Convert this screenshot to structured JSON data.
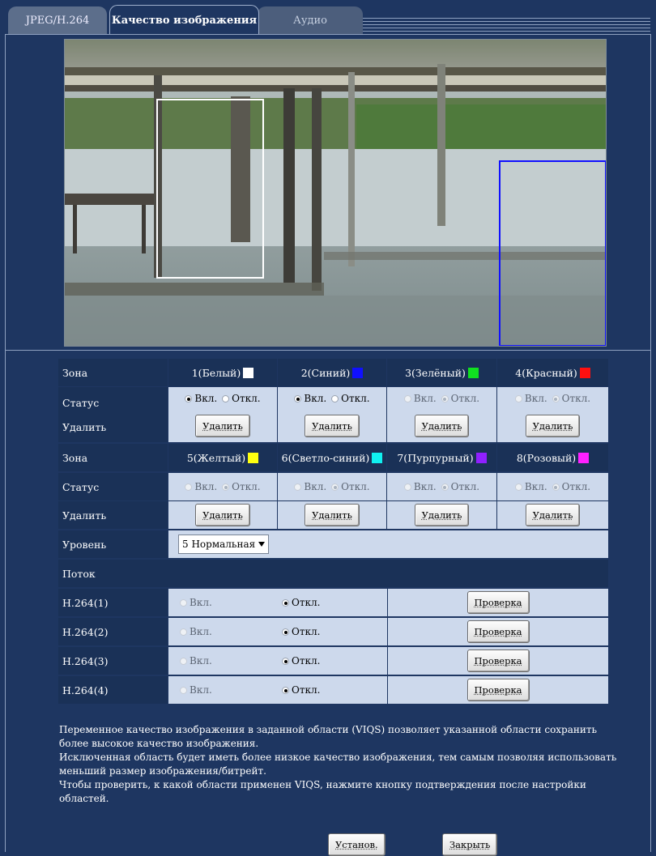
{
  "tabs": [
    {
      "label": "JPEG/H.264"
    },
    {
      "label": "Качество изображения"
    },
    {
      "label": "Аудио"
    }
  ],
  "zones_a": [
    {
      "label": "1(Белый)",
      "color": "#ffffff",
      "status": "on",
      "enabled": true
    },
    {
      "label": "2(Синий)",
      "color": "#1010ff",
      "status": "on",
      "enabled": true
    },
    {
      "label": "3(Зелёный)",
      "color": "#10e020",
      "status": "off",
      "enabled": false
    },
    {
      "label": "4(Красный)",
      "color": "#ff1010",
      "status": "off",
      "enabled": false
    }
  ],
  "zones_b": [
    {
      "label": "5(Желтый)",
      "color": "#ffff10",
      "status": "off",
      "enabled": false
    },
    {
      "label": "6(Светло-синий)",
      "color": "#10f0f0",
      "status": "off",
      "enabled": false
    },
    {
      "label": "7(Пурпурный)",
      "color": "#9020ff",
      "status": "off",
      "enabled": false
    },
    {
      "label": "8(Розовый)",
      "color": "#ff20ff",
      "status": "off",
      "enabled": false
    }
  ],
  "labels": {
    "zone": "Зона",
    "status": "Статус",
    "delete": "Удалить",
    "level": "Уровень",
    "stream": "Поток",
    "on": "Вкл.",
    "off": "Откл.",
    "delete_btn": "Удалить",
    "check_btn": "Проверка"
  },
  "level_value": "5 Нормальная",
  "streams": [
    {
      "name": "H.264(1)",
      "value": "off"
    },
    {
      "name": "H.264(2)",
      "value": "off"
    },
    {
      "name": "H.264(3)",
      "value": "off"
    },
    {
      "name": "H.264(4)",
      "value": "off"
    }
  ],
  "description": [
    "Переменное качество изображения в заданной области (VIQS) позволяет указанной области сохранить",
    "более высокое качество изображения.",
    "Исключенная область будет иметь более низкое качество изображения, тем самым позволяя использовать",
    "меньший размер изображения/битрейт.",
    "Чтобы проверить, к какой области применен VIQS, нажмите кнопку подтверждения после настройки",
    "областей."
  ],
  "buttons": {
    "set": "Установ.",
    "close": "Закрыть"
  },
  "colors": {
    "background": "#1e3661",
    "label_cell": "#1a3157",
    "value_cell": "#cdd9ec",
    "zone1_box": "#ffffff",
    "zone2_box": "#1010ff"
  }
}
